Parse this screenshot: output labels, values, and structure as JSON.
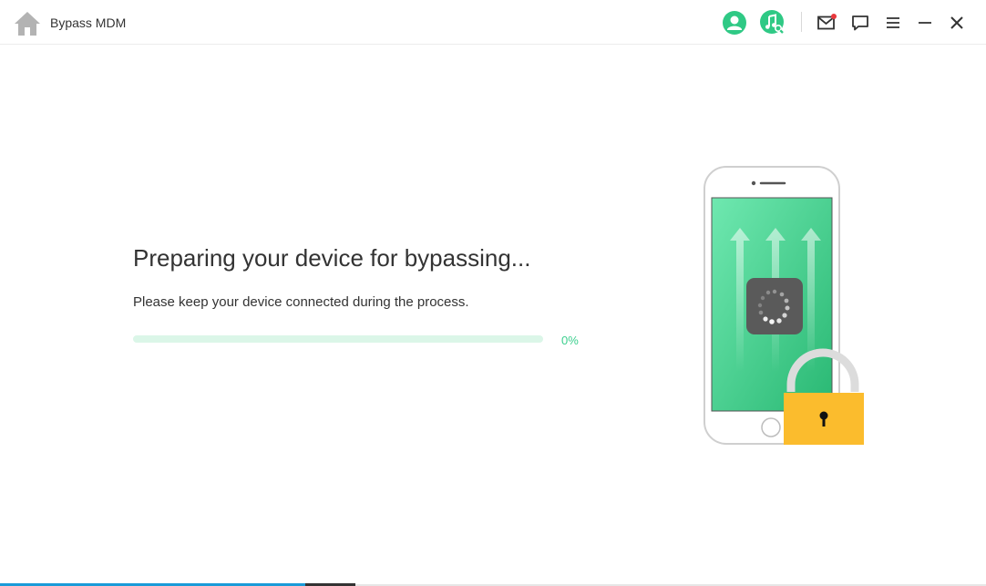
{
  "window": {
    "title": "Bypass MDM"
  },
  "toolbar": {
    "icons": [
      "home-icon",
      "account-icon",
      "music-search-icon",
      "mail-icon",
      "feedback-icon",
      "menu-icon",
      "minimize-icon",
      "close-icon"
    ]
  },
  "main": {
    "heading": "Preparing your device for bypassing...",
    "subtitle": "Please keep your device connected during the process.",
    "progress_percent": 0,
    "progress_label": "0%"
  },
  "colors": {
    "accent_green": "#33c98a",
    "progress_track": "#dbf6e8",
    "lock_yellow": "#fbbc2d",
    "notification_red": "#e8383d"
  }
}
